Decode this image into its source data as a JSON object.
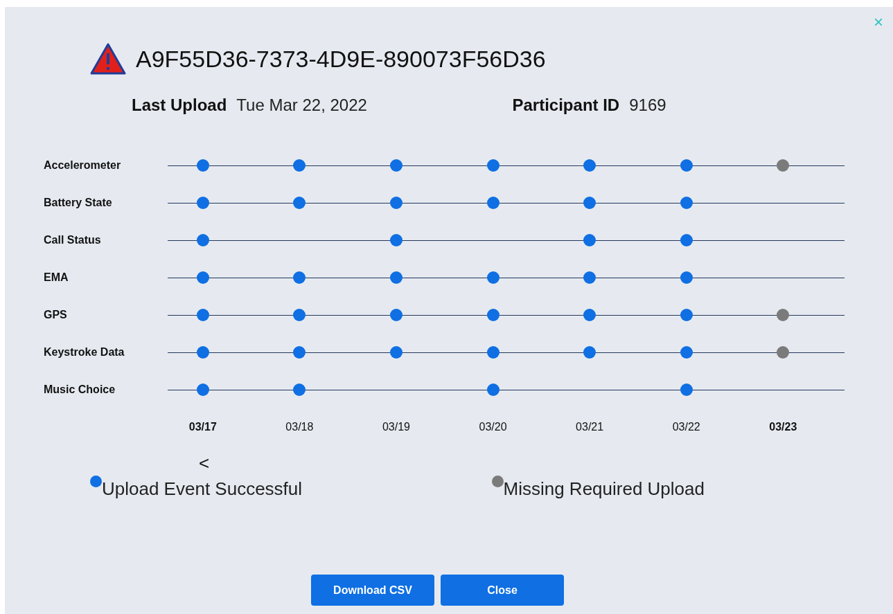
{
  "dialog": {
    "title": "A9F55D36-7373-4D9E-890073F56D36",
    "close_label": "×"
  },
  "info": [
    {
      "label": "Last Upload",
      "value": "Tue Mar 22, 2022"
    },
    {
      "label": "Participant ID",
      "value": "9169"
    }
  ],
  "streams": [
    {
      "name": "Accelerometer",
      "events": [
        {
          "uploaded": true,
          "color": "#0f6fe3"
        },
        {
          "uploaded": true,
          "color": "#0f6fe3"
        },
        {
          "uploaded": true,
          "color": "#0f6fe3"
        },
        {
          "uploaded": true,
          "color": "#0f6fe3"
        },
        {
          "uploaded": true,
          "color": "#0f6fe3"
        },
        {
          "uploaded": true,
          "color": "#0f6fe3"
        },
        {
          "uploaded": true,
          "color": "#7b7b7b"
        }
      ]
    },
    {
      "name": "Battery State",
      "events": [
        {
          "uploaded": true,
          "color": "#0f6fe3"
        },
        {
          "uploaded": true,
          "color": "#0f6fe3"
        },
        {
          "uploaded": true,
          "color": "#0f6fe3"
        },
        {
          "uploaded": true,
          "color": "#0f6fe3"
        },
        {
          "uploaded": true,
          "color": "#0f6fe3"
        },
        {
          "uploaded": true,
          "color": "#0f6fe3"
        },
        {
          "uploaded": false
        }
      ]
    },
    {
      "name": "Call Status",
      "events": [
        {
          "uploaded": true,
          "color": "#0f6fe3"
        },
        {
          "uploaded": false
        },
        {
          "uploaded": true,
          "color": "#0f6fe3"
        },
        {
          "uploaded": false
        },
        {
          "uploaded": true,
          "color": "#0f6fe3"
        },
        {
          "uploaded": true,
          "color": "#0f6fe3"
        },
        {
          "uploaded": false
        }
      ]
    },
    {
      "name": "EMA",
      "events": [
        {
          "uploaded": true,
          "color": "#0f6fe3"
        },
        {
          "uploaded": true,
          "color": "#0f6fe3"
        },
        {
          "uploaded": true,
          "color": "#0f6fe3"
        },
        {
          "uploaded": true,
          "color": "#0f6fe3"
        },
        {
          "uploaded": true,
          "color": "#0f6fe3"
        },
        {
          "uploaded": true,
          "color": "#0f6fe3"
        },
        {
          "uploaded": false
        }
      ]
    },
    {
      "name": "GPS",
      "events": [
        {
          "uploaded": true,
          "color": "#0f6fe3"
        },
        {
          "uploaded": true,
          "color": "#0f6fe3"
        },
        {
          "uploaded": true,
          "color": "#0f6fe3"
        },
        {
          "uploaded": true,
          "color": "#0f6fe3"
        },
        {
          "uploaded": true,
          "color": "#0f6fe3"
        },
        {
          "uploaded": true,
          "color": "#0f6fe3"
        },
        {
          "uploaded": true,
          "color": "#7b7b7b"
        }
      ]
    },
    {
      "name": "Keystroke Data",
      "events": [
        {
          "uploaded": true,
          "color": "#0f6fe3"
        },
        {
          "uploaded": true,
          "color": "#0f6fe3"
        },
        {
          "uploaded": true,
          "color": "#0f6fe3"
        },
        {
          "uploaded": true,
          "color": "#0f6fe3"
        },
        {
          "uploaded": true,
          "color": "#0f6fe3"
        },
        {
          "uploaded": true,
          "color": "#0f6fe3"
        },
        {
          "uploaded": true,
          "color": "#7b7b7b"
        }
      ]
    },
    {
      "name": "Music Choice",
      "events": [
        {
          "uploaded": true,
          "color": "#0f6fe3"
        },
        {
          "uploaded": true,
          "color": "#0f6fe3"
        },
        {
          "uploaded": false
        },
        {
          "uploaded": true,
          "color": "#0f6fe3"
        },
        {
          "uploaded": false
        },
        {
          "uploaded": true,
          "color": "#0f6fe3"
        },
        {
          "uploaded": false
        }
      ]
    }
  ],
  "dates": [
    {
      "label": "03/17",
      "bold": true
    },
    {
      "label": "03/18",
      "bold": false
    },
    {
      "label": "03/19",
      "bold": false
    },
    {
      "label": "03/20",
      "bold": false
    },
    {
      "label": "03/21",
      "bold": false
    },
    {
      "label": "03/22",
      "bold": false
    },
    {
      "label": "03/23",
      "bold": true
    }
  ],
  "prev_label": "<",
  "legend": [
    {
      "color": "#0f6fe3",
      "label": "Upload Event Successful"
    },
    {
      "color": "#7b7b7b",
      "label": "Missing Required Upload"
    }
  ],
  "buttons": [
    "Download CSV",
    "Close"
  ]
}
